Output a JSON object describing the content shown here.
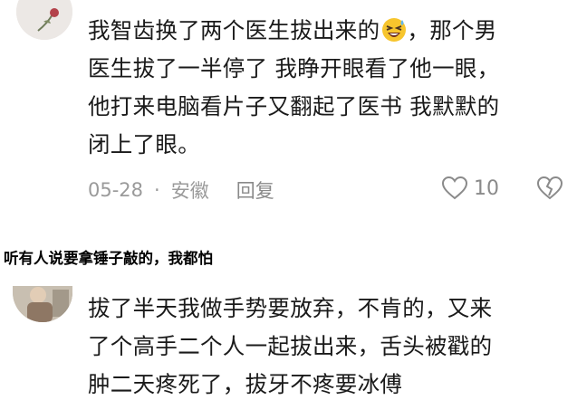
{
  "comment1": {
    "lines": [
      "我智齿换了两个医生拔出来的",
      "医生拔了一半停了 我睁开眼看了他一眼，",
      "他打来电脑看片子又翻起了医书 我默默的",
      "闭上了眼。"
    ],
    "line1_suffix": "，那个男",
    "emoji": "grinning-squinting-sweat-emoji",
    "date": "05-28",
    "separator": "·",
    "location": "安徽",
    "reply_label": "回复",
    "like_count": "10"
  },
  "caption": "听有人说要拿锤子敲的，我都怕",
  "comment2": {
    "lines": [
      "拔了半天我做手势要放弃，不肯的，又来",
      "了个高手二个人一起拔出来，舌头被戳的",
      "肿二天疼死了，拔牙不疼要冰傅"
    ]
  }
}
